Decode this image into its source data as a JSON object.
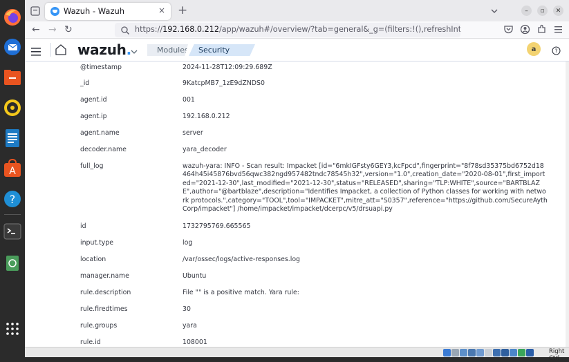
{
  "browser": {
    "tab_title": "Wazuh - Wazuh",
    "tab_close": "×",
    "new_tab": "+",
    "url_host": "192.168.0.212",
    "url_prefix": "https://",
    "url_path": "/app/wazuh#/overview/?tab=general&_g=(filters:!(),refreshInterval:(pause:!t,valu",
    "window_minimize": "–",
    "window_maximize": "▫",
    "window_close": "✕"
  },
  "wazuh": {
    "logo_text": "wazuh",
    "logo_dot": ".",
    "breadcrumb_modules": "Modules",
    "breadcrumb_current": "Security events",
    "avatar_letter": "a"
  },
  "fields": [
    {
      "key": "@timestamp",
      "value": "2024-11-28T12:09:29.689Z"
    },
    {
      "key": "_id",
      "value": "9KatcpMB7_1zE9dZNDS0"
    },
    {
      "key": "agent.id",
      "value": "001"
    },
    {
      "key": "agent.ip",
      "value": "192.168.0.212"
    },
    {
      "key": "agent.name",
      "value": "server"
    },
    {
      "key": "decoder.name",
      "value": "yara_decoder"
    },
    {
      "key": "full_log",
      "value": "wazuh-yara: INFO - Scan result: Impacket [id=\"6mkIGFsty6GEY3,kcFpcd\",fingerprint=\"8f78sd35375bd6752d18464h45i45876bvd56qwc382ngd957482tndc78545h32\",version=\"1.0\",creation_date=\"2020-08-01\",first_imported=\"2021-12-30\",last_modified=\"2021-12-30\",status=\"RELEASED\",sharing=\"TLP:WHITE\",source=\"BARTBLAZE\",author=\"@bartblaze\",description=\"Identifies Impacket, a collection of Python classes for working with network protocols.\",category=\"TOOL\",tool=\"IMPACKET\",mitre_att=\"S0357\",reference=\"https://github.com/SecureAythCorp/impacket\"] /home/impacket/impacket/dcerpc/v5/drsuapi.py"
    },
    {
      "key": "id",
      "value": "1732795769.665565"
    },
    {
      "key": "input.type",
      "value": "log"
    },
    {
      "key": "location",
      "value": "/var/ossec/logs/active-responses.log"
    },
    {
      "key": "manager.name",
      "value": "Ubuntu"
    },
    {
      "key": "rule.description",
      "value": "File \"\" is a positive match. Yara rule:"
    },
    {
      "key": "rule.firedtimes",
      "value": "30"
    },
    {
      "key": "rule.groups",
      "value": "yara"
    },
    {
      "key": "rule.id",
      "value": "108001"
    }
  ],
  "statusbar": {
    "host_key": "Right Ctrl"
  },
  "colors": {
    "accent": "#3595f6",
    "breadcrumb_current_bg": "#d6e6f8",
    "avatar_bg": "#f3d371"
  }
}
